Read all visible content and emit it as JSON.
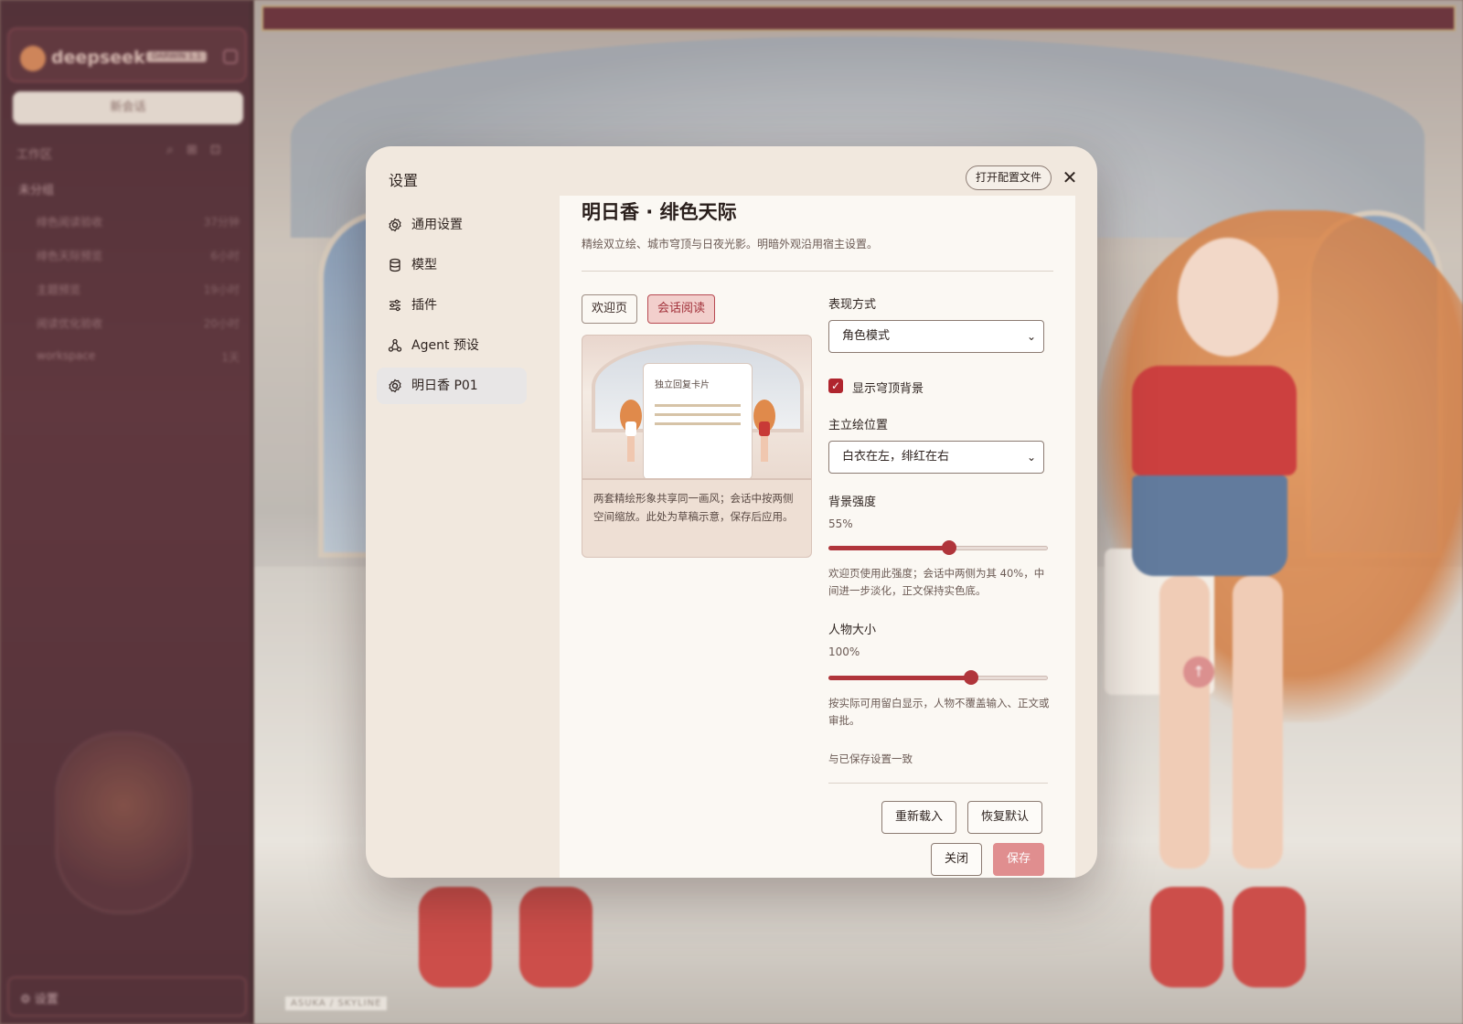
{
  "app": {
    "logo": "deepseek",
    "logo_badge": "DARWIN 1.1",
    "new_chat": "新会话",
    "section_label": "工作区",
    "folder": "未分组",
    "items": [
      {
        "label": "绯色阅读验收",
        "meta": "37分钟"
      },
      {
        "label": "绯色天际预览",
        "meta": "6小时"
      },
      {
        "label": "主题预览",
        "meta": "19小时"
      },
      {
        "label": "阅读优化验收",
        "meta": "20小时"
      },
      {
        "label": "workspace",
        "meta": "1天"
      }
    ],
    "footer_settings": "设置",
    "stage_caption": "ASUKA / SKYLINE"
  },
  "modal": {
    "title": "设置",
    "open_config": "打开配置文件",
    "close_glyph": "✕",
    "nav": [
      {
        "label": "通用设置",
        "icon": "gear-icon"
      },
      {
        "label": "模型",
        "icon": "database-icon"
      },
      {
        "label": "插件",
        "icon": "sliders-icon"
      },
      {
        "label": "Agent 预设",
        "icon": "agent-icon"
      },
      {
        "label": "明日香 P01",
        "icon": "gear-icon",
        "active": true
      }
    ]
  },
  "theme": {
    "title": "明日香 · 绯色天际",
    "subtitle": "精绘双立绘、城市穹顶与日夜光影。明暗外观沿用宿主设置。",
    "tabs": [
      {
        "label": "欢迎页",
        "selected": false
      },
      {
        "label": "会话阅读",
        "selected": true
      }
    ],
    "preview_card_label": "独立回复卡片",
    "preview_note": "两套精绘形象共享同一画风；会话中按两侧空间缩放。此处为草稿示意，保存后应用。"
  },
  "form": {
    "mode_label": "表现方式",
    "mode_value": "角色模式",
    "dome_label": "显示穹顶背景",
    "dome_checked": true,
    "position_label": "主立绘位置",
    "position_value": "白衣在左，绯红在右",
    "bg_label": "背景强度",
    "bg_value_text": "55%",
    "bg_value": 55,
    "bg_hint": "欢迎页使用此强度；会话中两侧为其 40%，中间进一步淡化，正文保持实色底。",
    "size_label": "人物大小",
    "size_value_text": "100%",
    "size_fraction": 0.65,
    "size_hint": "按实际可用留白显示，人物不覆盖输入、正文或审批。",
    "status": "与已保存设置一致"
  },
  "buttons": {
    "reload": "重新载入",
    "reset": "恢复默认",
    "close": "关闭",
    "save": "保存"
  },
  "colors": {
    "accent": "#b0353b",
    "save": "#e08e8f",
    "sidebar": "#4a1c26",
    "modal_bg": "#f1e8de"
  }
}
